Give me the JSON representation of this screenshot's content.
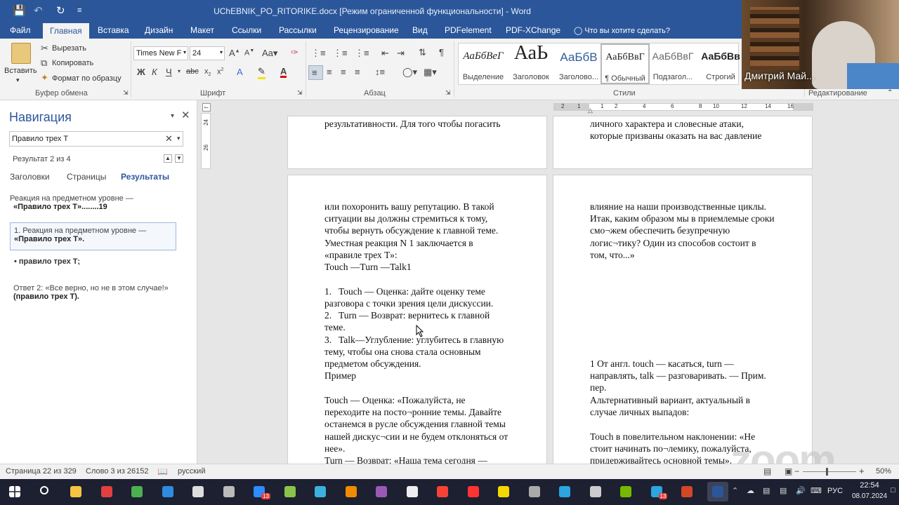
{
  "window": {
    "title": "UChEBNIK_PO_RITORIKE.docx [Режим ограниченной функциональности] - Word"
  },
  "quick_access": {
    "save_icon": "save-icon",
    "undo_icon": "undo-icon",
    "redo_icon": "redo-icon",
    "customize_icon": "customize-icon"
  },
  "tabs": [
    "Файл",
    "Главная",
    "Вставка",
    "Дизайн",
    "Макет",
    "Ссылки",
    "Рассылки",
    "Рецензирование",
    "Вид",
    "PDFelement",
    "PDF-XChange"
  ],
  "tell_me": "Что вы хотите сделать?",
  "ribbon": {
    "paste": "Вставить",
    "cut": "Вырезать",
    "copy": "Копировать",
    "format_painter": "Формат по образцу",
    "clipboard_group": "Буфер обмена",
    "font_name": "Times New F",
    "font_size": "24",
    "font_group": "Шрифт",
    "paragraph_group": "Абзац",
    "styles_group": "Стили",
    "editing_group": "Редактирование",
    "styles": [
      {
        "sample": "АаБбВеГ",
        "name": "Выделение"
      },
      {
        "sample": "АаЬ",
        "name": "Заголовок"
      },
      {
        "sample": "АаБбВ",
        "name": "Заголово..."
      },
      {
        "sample": "АаБбВвГ",
        "name": "¶ Обычный"
      },
      {
        "sample": "АаБбВвГ",
        "name": "Подзагол..."
      },
      {
        "sample": "АаБбВв",
        "name": "Строгий"
      }
    ]
  },
  "webcam": {
    "name": "Дмитрий Май..."
  },
  "nav": {
    "title": "Навигация",
    "search_value": "Правило трех Т",
    "result_count": "Результат 2 из 4",
    "tabs": [
      "Заголовки",
      "Страницы",
      "Результаты"
    ],
    "results": [
      {
        "line1": "Реакция на предметном уровне —",
        "line2": "«Правило трех Т»........19"
      },
      {
        "line1": "1. Реакция на предметном уровне —",
        "line2": "«Правило трех Т»."
      },
      {
        "line1": "•  правило трех Т;",
        "line2": ""
      },
      {
        "line1": "Ответ 2: «Все верно, но не в этом случае!»",
        "line2": "(правило трех Т)."
      }
    ]
  },
  "ruler_numbers": [
    "2",
    "1",
    "1",
    "2",
    "4",
    "6",
    "8",
    "10",
    "12",
    "14",
    "16"
  ],
  "vruler_numbers": [
    "24",
    "26"
  ],
  "pages": {
    "top_left": [
      "результативности. Для того чтобы погасить"
    ],
    "top_right": [
      "личного характера и словесные атаки,",
      "которые призваны оказать на вас давление"
    ],
    "left": [
      "или похоронить вашу репутацию. В такой",
      "ситуации вы должны стремиться к тому,",
      "чтобы вернуть обсуждение к главной теме.",
      "Уместная реакция N 1 заключается в",
      "«правиле трех Т»:",
      "Touch —Turn —Talk1",
      "",
      "1.   Touch — Оценка: дайте оценку теме",
      "разговора с точки зрения цели дискуссии.",
      "2.   Turn — Возврат: вернитесь к главной",
      "теме.",
      "3.   Talk—Углубление: углубитесь в главную",
      "тему, чтобы она снова стала основным",
      "предметом обсуждения.",
      "Пример",
      "",
      "Touch — Оценка: «Пожалуйста, не",
      "переходите на посто¬ронние темы. Давайте",
      "останемся в русле обсуждения главной темы",
      "нашей дискус¬сии и не будем отклоняться от",
      "нее».",
      "Turn — Возврат: «Наша тема сегодня —"
    ],
    "right_top": [
      "влияние на наши производственные циклы.",
      "Итак, каким образом мы в приемлемые сроки",
      "смо¬жем обеспечить безупречную",
      "логис¬тику? Один из способов состоит в",
      "том, что...»"
    ],
    "right_bottom": [
      "1 От англ. touch — касаться, turn —",
      "направлять, talk — разговаривать. — Прим.",
      "пер.",
      "Альтернативный вариант, актуальный в",
      "случае личных выпадов:",
      "",
      "Touch в повелительном наклонении: «Не",
      "стоит начинать по¬лемику, пожалуйста,",
      "придерживайтесь основной темы»."
    ]
  },
  "watermark": "zoom",
  "status": {
    "page": "Страница 22 из 329",
    "words": "Слово 3 из 26152",
    "language": "русский",
    "zoom": "50%"
  },
  "taskbar": {
    "language": "РУС",
    "time": "22:54",
    "date": "08.07.2024",
    "badge": "13",
    "apps": [
      {
        "name": "start-button",
        "color": "#ffffff"
      },
      {
        "name": "search-icon",
        "color": "#ffffff"
      },
      {
        "name": "file-explorer-icon",
        "color": "#f4c542"
      },
      {
        "name": "app-red-icon",
        "color": "#e04040"
      },
      {
        "name": "chrome-icon",
        "color": "#4caf50"
      },
      {
        "name": "edge-icon",
        "color": "#2f8be0"
      },
      {
        "name": "store-icon",
        "color": "#dddddd"
      },
      {
        "name": "calculator-icon",
        "color": "#bbbbbb"
      },
      {
        "name": "zoom-app-icon",
        "color": "#2d8cff"
      },
      {
        "name": "paint-icon",
        "color": "#8bc34a"
      },
      {
        "name": "arrow-app-icon",
        "color": "#3cb0e0"
      },
      {
        "name": "vlc-icon",
        "color": "#f08c00"
      },
      {
        "name": "onenote-icon",
        "color": "#9b59b6"
      },
      {
        "name": "notepad-icon",
        "color": "#eeeeee"
      },
      {
        "name": "yandex-browser-icon",
        "color": "#f44336"
      },
      {
        "name": "yandex-icon",
        "color": "#ff3333"
      },
      {
        "name": "app-yellow-icon",
        "color": "#f5d800"
      },
      {
        "name": "app-grey-icon",
        "color": "#aaaaaa"
      },
      {
        "name": "telegram-icon",
        "color": "#2ca5e0"
      },
      {
        "name": "settings-icon",
        "color": "#cccccc"
      },
      {
        "name": "torrent-icon",
        "color": "#76b900"
      },
      {
        "name": "telegram2-icon",
        "color": "#2ca5e0"
      },
      {
        "name": "powerpoint-icon",
        "color": "#d24726"
      },
      {
        "name": "word-icon",
        "color": "#2b579a"
      }
    ]
  }
}
